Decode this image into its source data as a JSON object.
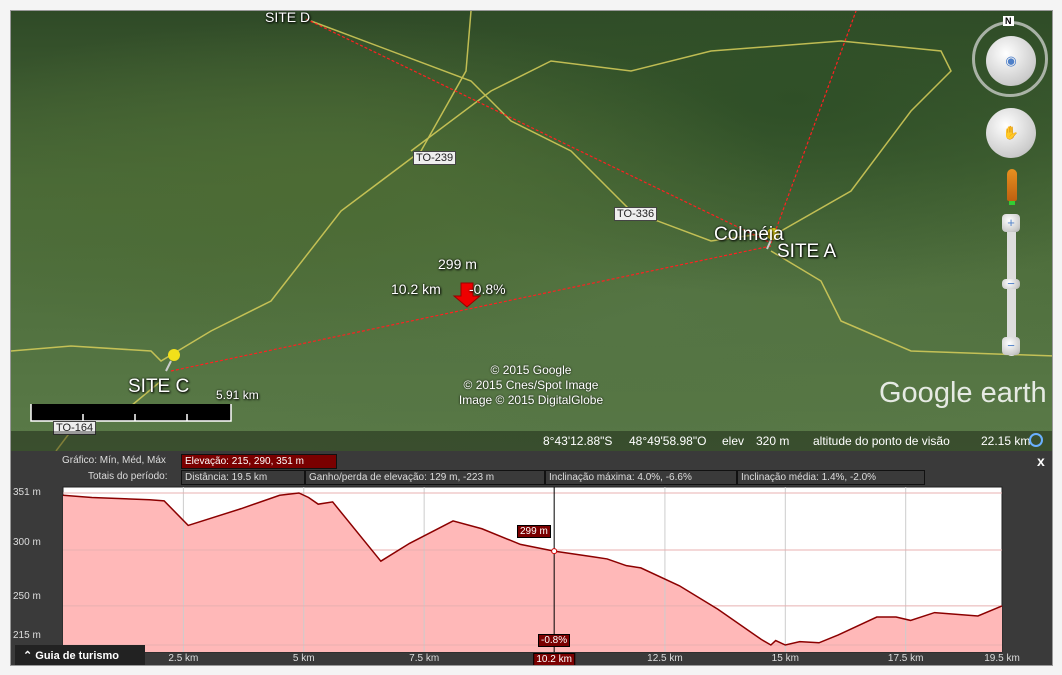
{
  "map": {
    "placemarks": [
      "SITE D",
      "SITE A",
      "SITE C"
    ],
    "town": "Colméia",
    "roads": [
      "TO-239",
      "TO-336",
      "TO-164"
    ],
    "cursor": {
      "elevation": "299 m",
      "distance": "10.2 km",
      "slope": "-0.8%"
    },
    "scale": "5.91 km",
    "copyright": [
      "© 2015 Google",
      "© 2015 Cnes/Spot Image",
      "Image © 2015 DigitalGlobe"
    ],
    "logo": "Google earth",
    "compass_n": "N",
    "status": {
      "lat": "8°43'12.88\"S",
      "lon": "48°49'58.98\"O",
      "elev_label": "elev",
      "elev": "320 m",
      "eye_label": "altitude do ponto de visão",
      "eye": "22.15 km"
    }
  },
  "profile": {
    "graph_label": "Gráfico: Mín, Méd, Máx",
    "elevation": "Elevação: 215, 290, 351 m",
    "totals_label": "Totais do período:",
    "distance": "Distância: 19.5 km",
    "gain": "Ganho/perda de elevação: 129 m, -223 m",
    "max_slope": "Inclinação máxima: 4.0%, -6.6%",
    "avg_slope": "Inclinação média: 1.4%, -2.0%",
    "close": "x",
    "tour_guide": "Guia de turismo",
    "cursor_elev": "299 m",
    "cursor_slope": "-0.8%",
    "cursor_dist": "10.2 km"
  },
  "chart_data": {
    "type": "area",
    "xlabel": "",
    "ylabel": "",
    "x_ticks": [
      "2.5 km",
      "5 km",
      "7.5 km",
      "10.2 km",
      "12.5 km",
      "15 km",
      "17.5 km",
      "19.5 km"
    ],
    "y_ticks": [
      "351 m",
      "300 m",
      "250 m",
      "215 m"
    ],
    "xlim": [
      0,
      19.5
    ],
    "ylim": [
      215,
      351
    ],
    "colors": {
      "line": "#8b0000",
      "fill": "#ffb8b8"
    },
    "points": [
      [
        0,
        349
      ],
      [
        0.6,
        347
      ],
      [
        1.8,
        345
      ],
      [
        2.1,
        344
      ],
      [
        2.6,
        322
      ],
      [
        3.7,
        337
      ],
      [
        4.5,
        349
      ],
      [
        4.9,
        351
      ],
      [
        5.1,
        347
      ],
      [
        5.3,
        341
      ],
      [
        5.6,
        343
      ],
      [
        6.6,
        290
      ],
      [
        7.2,
        306
      ],
      [
        8.1,
        326
      ],
      [
        8.7,
        319
      ],
      [
        9.5,
        305
      ],
      [
        10.2,
        299
      ],
      [
        11.0,
        294
      ],
      [
        11.3,
        292
      ],
      [
        11.7,
        286
      ],
      [
        12.0,
        284
      ],
      [
        12.8,
        268
      ],
      [
        13.6,
        247
      ],
      [
        14.5,
        220
      ],
      [
        14.7,
        215
      ],
      [
        14.8,
        219
      ],
      [
        15.0,
        215
      ],
      [
        15.3,
        218
      ],
      [
        15.7,
        217
      ],
      [
        16.1,
        224
      ],
      [
        16.9,
        240
      ],
      [
        17.3,
        240
      ],
      [
        17.6,
        237
      ],
      [
        18.1,
        244
      ],
      [
        19.0,
        241
      ],
      [
        19.5,
        250
      ]
    ]
  }
}
